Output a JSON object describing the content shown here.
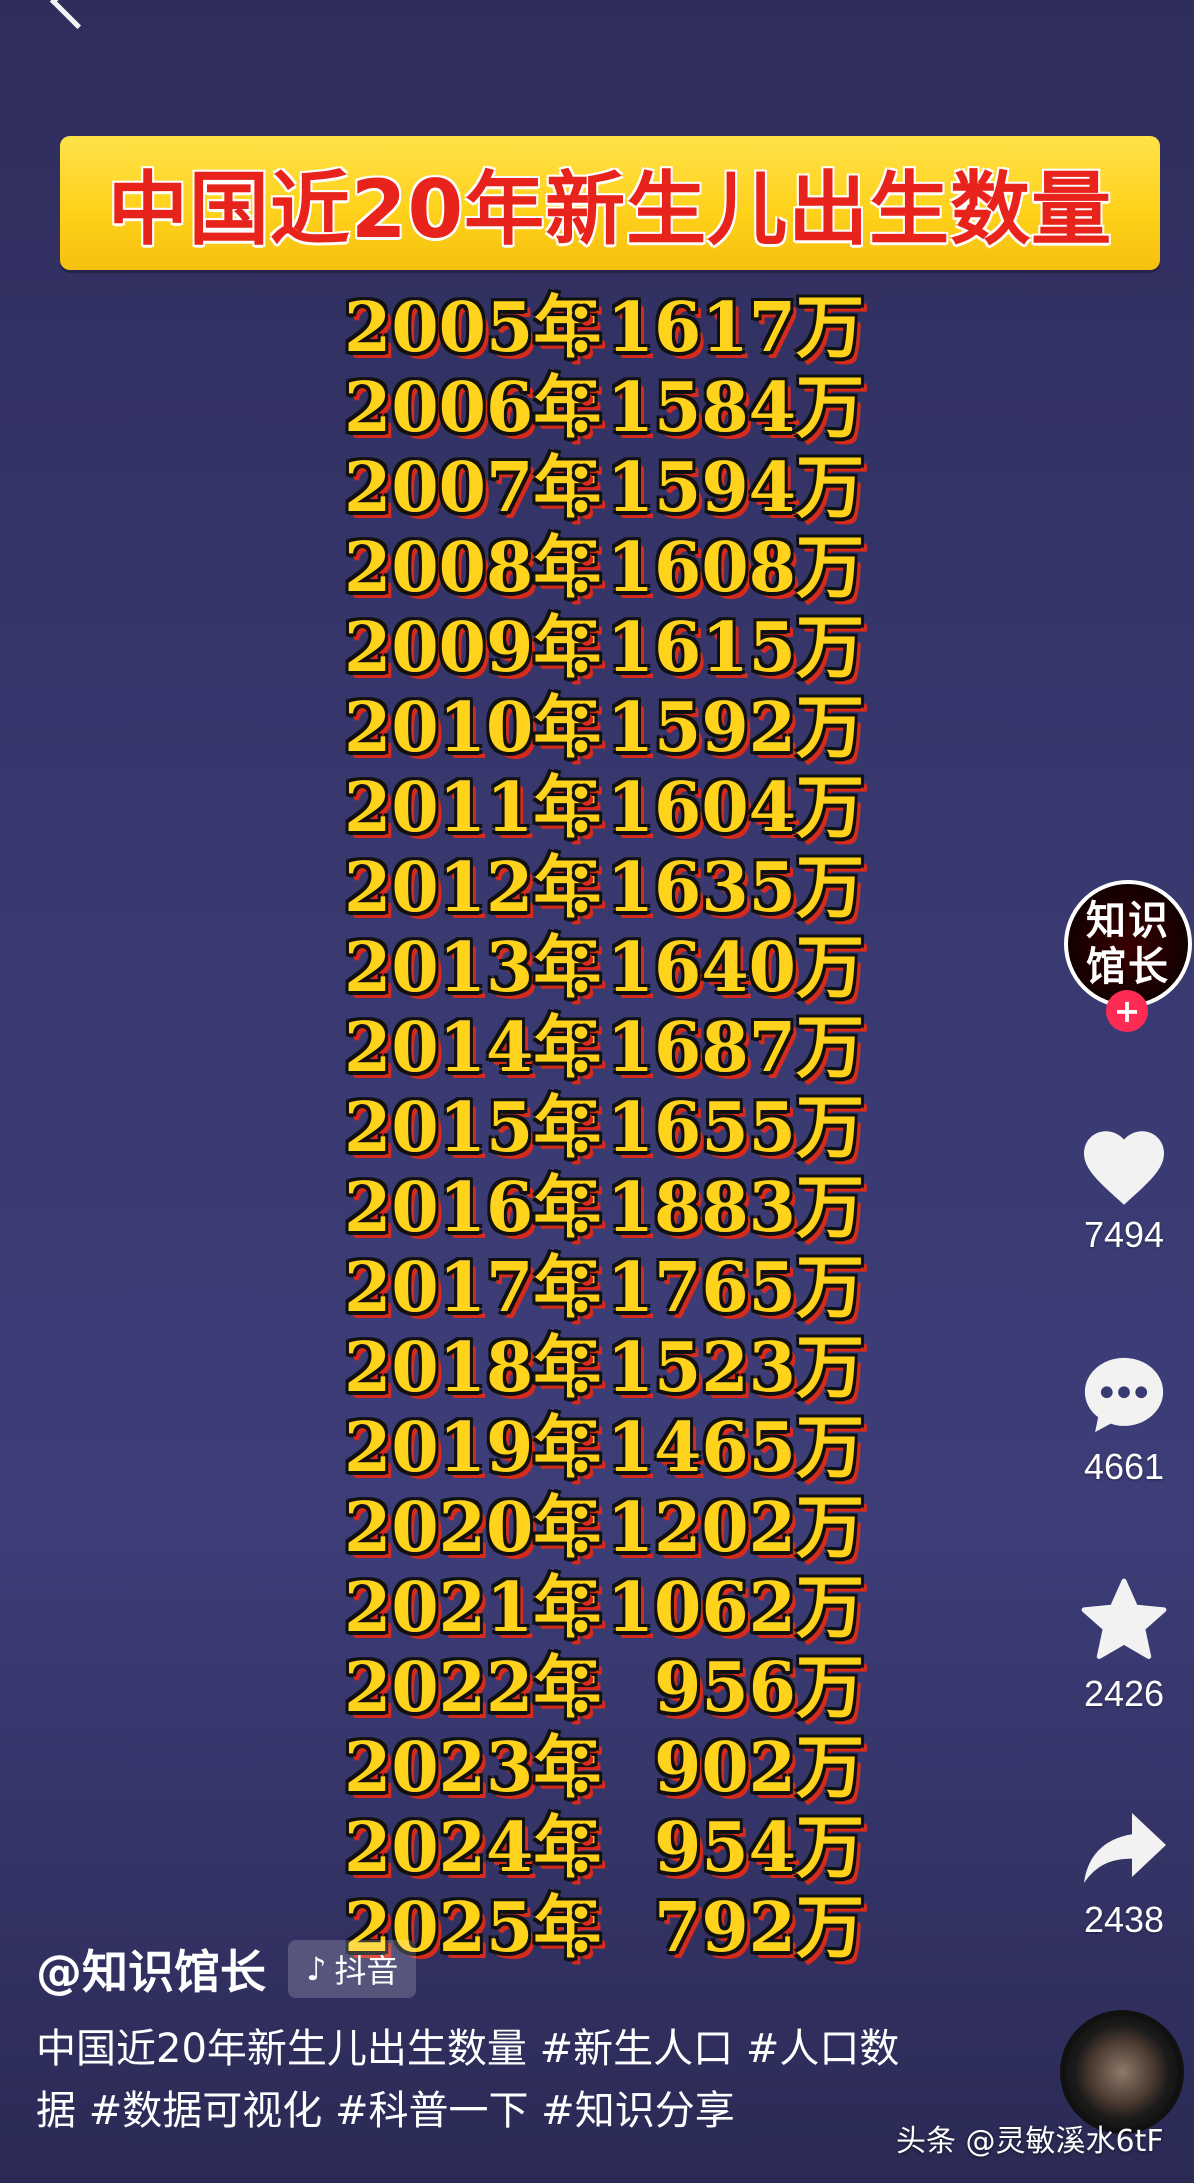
{
  "header": {
    "title": "中国近20年新生儿出生数量"
  },
  "rows": [
    {
      "year": "2005年",
      "colon": "：",
      "value": "1617万"
    },
    {
      "year": "2006年",
      "colon": "：",
      "value": "1584万"
    },
    {
      "year": "2007年",
      "colon": "：",
      "value": "1594万"
    },
    {
      "year": "2008年",
      "colon": "：",
      "value": "1608万"
    },
    {
      "year": "2009年",
      "colon": "：",
      "value": "1615万"
    },
    {
      "year": "2010年",
      "colon": "：",
      "value": "1592万"
    },
    {
      "year": "2011年",
      "colon": "：",
      "value": "1604万"
    },
    {
      "year": "2012年",
      "colon": "：",
      "value": "1635万"
    },
    {
      "year": "2013年",
      "colon": "：",
      "value": "1640万"
    },
    {
      "year": "2014年",
      "colon": "：",
      "value": "1687万"
    },
    {
      "year": "2015年",
      "colon": "：",
      "value": "1655万"
    },
    {
      "year": "2016年",
      "colon": "：",
      "value": "1883万"
    },
    {
      "year": "2017年",
      "colon": "：",
      "value": "1765万"
    },
    {
      "year": "2018年",
      "colon": "：",
      "value": "1523万"
    },
    {
      "year": "2019年",
      "colon": "：",
      "value": "1465万"
    },
    {
      "year": "2020年",
      "colon": "：",
      "value": "1202万"
    },
    {
      "year": "2021年",
      "colon": "：",
      "value": "1062万"
    },
    {
      "year": "2022年",
      "colon": "：",
      "value": "956万"
    },
    {
      "year": "2023年",
      "colon": "：",
      "value": "902万"
    },
    {
      "year": "2024年",
      "colon": "：",
      "value": "954万"
    },
    {
      "year": "2025年",
      "colon": "：",
      "value": "792万"
    }
  ],
  "sidebar": {
    "avatar_line1": "知识",
    "avatar_line2": "馆长",
    "follow_symbol": "+",
    "likes": "7494",
    "comments": "4661",
    "favorites": "2426",
    "shares": "2438"
  },
  "author": {
    "name": "@知识馆长",
    "platform": "抖音",
    "platform_icon": "♪"
  },
  "caption": "中国近20年新生儿出生数量 #新生人口 #人口数据 #数据可视化 #科普一下 #知识分享",
  "watermark": "头条 @灵敏溪水6tF",
  "colors": {
    "banner": "#ffd21b",
    "title_red": "#e8231b",
    "number_gold": "#ffd21b",
    "follow_pink": "#fe2c55"
  }
}
